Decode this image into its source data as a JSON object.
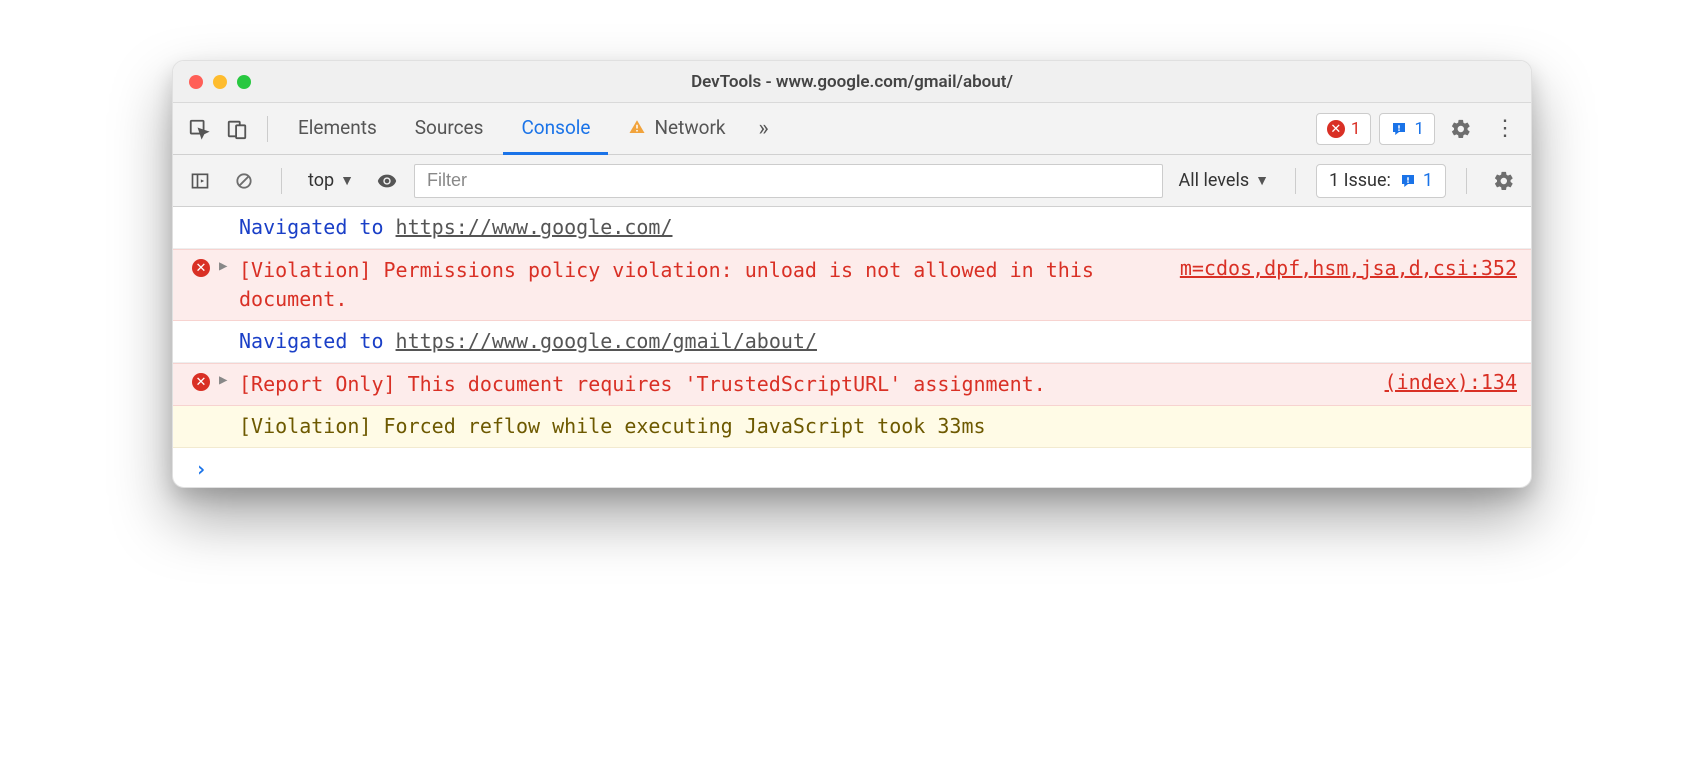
{
  "title": "DevTools - www.google.com/gmail/about/",
  "tabs": {
    "elements": "Elements",
    "sources": "Sources",
    "console": "Console",
    "network": "Network"
  },
  "tabbarRight": {
    "errorCount": "1",
    "issueCount": "1"
  },
  "toolbar": {
    "context": "top",
    "filterPlaceholder": "Filter",
    "levels": "All levels",
    "issuesLabel": "1 Issue:",
    "issuesCount": "1"
  },
  "logs": [
    {
      "type": "nav",
      "prefix": "Navigated to ",
      "url": "https://www.google.com/"
    },
    {
      "type": "error",
      "expandable": true,
      "text": "[Violation] Permissions policy violation: unload is not allowed in this document.",
      "src": "m=cdos,dpf,hsm,jsa,d,csi:352"
    },
    {
      "type": "nav",
      "prefix": "Navigated to ",
      "url": "https://www.google.com/gmail/about/"
    },
    {
      "type": "error",
      "expandable": true,
      "text": "[Report Only] This document requires 'TrustedScriptURL' assignment.",
      "src": "(index):134"
    },
    {
      "type": "warn",
      "text": "[Violation] Forced reflow while executing JavaScript took 33ms"
    }
  ]
}
